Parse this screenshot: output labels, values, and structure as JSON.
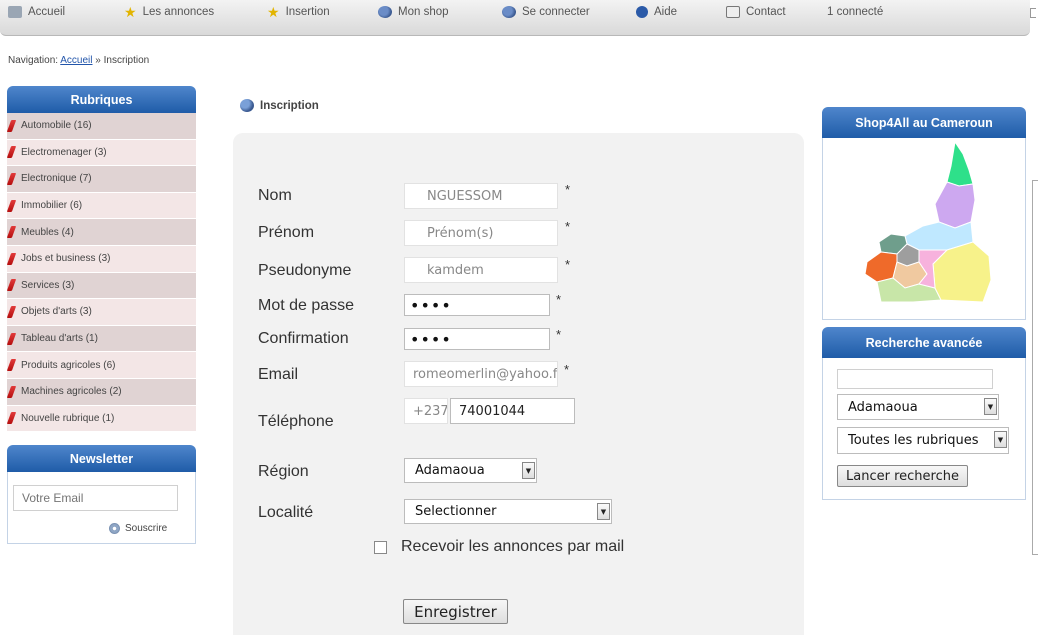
{
  "nav": {
    "items": [
      {
        "label": "Accueil",
        "icon": "home-icon"
      },
      {
        "label": "Les annonces",
        "icon": "star-icon"
      },
      {
        "label": "Insertion",
        "icon": "star-icon"
      },
      {
        "label": "Mon shop",
        "icon": "people-icon"
      },
      {
        "label": "Se connecter",
        "icon": "people-icon"
      },
      {
        "label": "Aide",
        "icon": "help-icon"
      },
      {
        "label": "Contact",
        "icon": "contact-icon"
      },
      {
        "label": "1 connecté"
      }
    ]
  },
  "breadcrumb": {
    "prefix": "Navigation:",
    "home": "Accueil",
    "separator": "»",
    "current": "Inscription"
  },
  "rubriques": {
    "title": "Rubriques",
    "items": [
      {
        "label": "Automobile (16)"
      },
      {
        "label": "Electromenager (3)"
      },
      {
        "label": "Electronique (7)"
      },
      {
        "label": "Immobilier (6)"
      },
      {
        "label": "Meubles (4)"
      },
      {
        "label": "Jobs et business (3)"
      },
      {
        "label": "Services (3)"
      },
      {
        "label": "Objets d'arts (3)"
      },
      {
        "label": "Tableau d'arts (1)"
      },
      {
        "label": "Produits agricoles (6)"
      },
      {
        "label": "Machines agricoles (2)"
      },
      {
        "label": "Nouvelle rubrique (1)"
      }
    ]
  },
  "newsletter": {
    "title": "Newsletter",
    "placeholder": "Votre Email",
    "subscribe": "Souscrire"
  },
  "form": {
    "title": "Inscription",
    "nom": {
      "label": "Nom",
      "value": "NGUESSOM"
    },
    "prenom": {
      "label": "Prénom",
      "placeholder": "Prénom(s)"
    },
    "pseudo": {
      "label": "Pseudonyme",
      "value": "kamdem"
    },
    "password": {
      "label": "Mot de passe",
      "value": "••••"
    },
    "confirmation": {
      "label": "Confirmation",
      "value": "••••"
    },
    "email": {
      "label": "Email",
      "value": "romeomerlin@yahoo.f"
    },
    "telephone": {
      "label": "Téléphone",
      "prefix": "+237",
      "value": "74001044"
    },
    "region": {
      "label": "Région",
      "selected": "Adamaoua"
    },
    "localite": {
      "label": "Localité",
      "selected": "Selectionner"
    },
    "mail_opt": {
      "label": "Recevoir les annonces par mail",
      "checked": false
    },
    "submit": "Enregistrer",
    "required_mark": "*"
  },
  "map": {
    "title": "Shop4All au Cameroun",
    "region_colors": [
      "#2ee08a",
      "#cda8f0",
      "#bfe8ff",
      "#6f9e8c",
      "#9e9e9e",
      "#ef6a2a",
      "#f0c9a0",
      "#c8e6a8",
      "#f7f28a",
      "#f7b2dd"
    ]
  },
  "recherche": {
    "title": "Recherche avancée",
    "region_selected": "Adamaoua",
    "rubrique_selected": "Toutes les rubriques",
    "button": "Lancer recherche"
  }
}
